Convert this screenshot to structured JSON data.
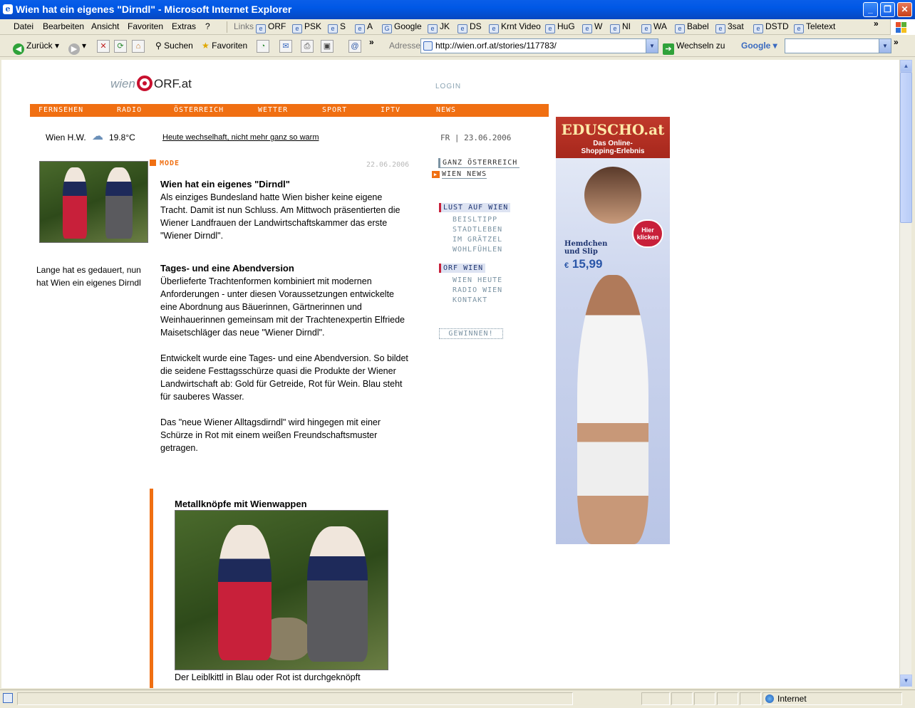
{
  "window": {
    "title": "Wien hat ein eigenes \"Dirndl\" - Microsoft Internet Explorer"
  },
  "menu": [
    "Datei",
    "Bearbeiten",
    "Ansicht",
    "Favoriten",
    "Extras",
    "?"
  ],
  "links": {
    "label": "Links",
    "items": [
      "ORF",
      "PSK",
      "S",
      "A",
      "Google",
      "JK",
      "DS",
      "Krnt Video",
      "HuG",
      "W",
      "NI",
      "WA",
      "Babel",
      "3sat",
      "DSTD",
      "Teletext"
    ]
  },
  "toolbar": {
    "back": "Zurück",
    "search": "Suchen",
    "favorites": "Favoriten",
    "address_label": "Adresse",
    "url": "http://wien.orf.at/stories/117783/",
    "go": "Wechseln zu",
    "google": "Google"
  },
  "status": {
    "zone": "Internet"
  },
  "site": {
    "logo_wien": "wien",
    "logo_orf": "ORF.at",
    "login": "LOGIN",
    "nav": [
      "FERNSEHEN",
      "RADIO",
      "ÖSTERREICH",
      "WETTER",
      "SPORT",
      "IPTV",
      "NEWS"
    ],
    "weather_station": "Wien H.W.",
    "temperature": "19.8°C",
    "forecast": "Heute wechselhaft, nicht mehr ganz so warm",
    "date": "FR | 23.06.2006"
  },
  "article": {
    "category": "MODE",
    "date": "22.06.2006",
    "title": "Wien hat ein eigenes \"Dirndl\"",
    "lead": "Als einziges Bundesland hatte Wien bisher keine eigene Tracht. Damit ist nun Schluss. Am Mittwoch präsentierten die Wiener Landfrauen der Landwirtschaftskammer das erste \"Wiener Dirndl\".",
    "caption": "Lange hat es gedauert, nun hat Wien ein eigenes Dirndl",
    "h2": "Tages- und eine Abendversion",
    "p1": "Überlieferte Trachtenformen kombiniert mit modernen Anforderungen - unter diesen Voraussetzungen entwickelte eine Abordnung aus Bäuerinnen, Gärtnerinnen und Weinhauerinnen gemeinsam mit der Trachtenexpertin Elfriede Maisetschläger das neue \"Wiener Dirndl\".",
    "p2": "Entwickelt wurde eine Tages- und eine Abendversion. So bildet die seidene Festtagsschürze quasi die Produkte der Wiener Landwirtschaft ab: Gold für Getreide, Rot für Wein. Blau steht für sauberes Wasser.",
    "p3": "Das \"neue Wiener Alltagsdirndl\" wird hingegen mit einer Schürze in Rot mit einem weißen Freundschaftsmuster getragen.",
    "box_title": "Metallknöpfe mit Wienwappen",
    "box_text": "Der Leiblkittl in Blau oder Rot ist durchgeknöpft"
  },
  "sidebar": {
    "tab1": "GANZ ÖSTERREICH",
    "tab2": "WIEN NEWS",
    "section1": "LUST AUF WIEN",
    "section1_items": [
      "BEISLTIPP",
      "STADTLEBEN",
      "IM GRÄTZEL",
      "WOHLFÜHLEN"
    ],
    "section2": "ORF WIEN",
    "section2_items": [
      "WIEN HEUTE",
      "RADIO WIEN",
      "KONTAKT"
    ],
    "win": "GEWINNEN!"
  },
  "ad": {
    "brand": "EDUSCHO.at",
    "tagline": "Das Online-Shopping-Erlebnis",
    "cta": "Hier klicken",
    "product": "Hemdchen und Slip",
    "currency": "€",
    "price": "15,99"
  }
}
